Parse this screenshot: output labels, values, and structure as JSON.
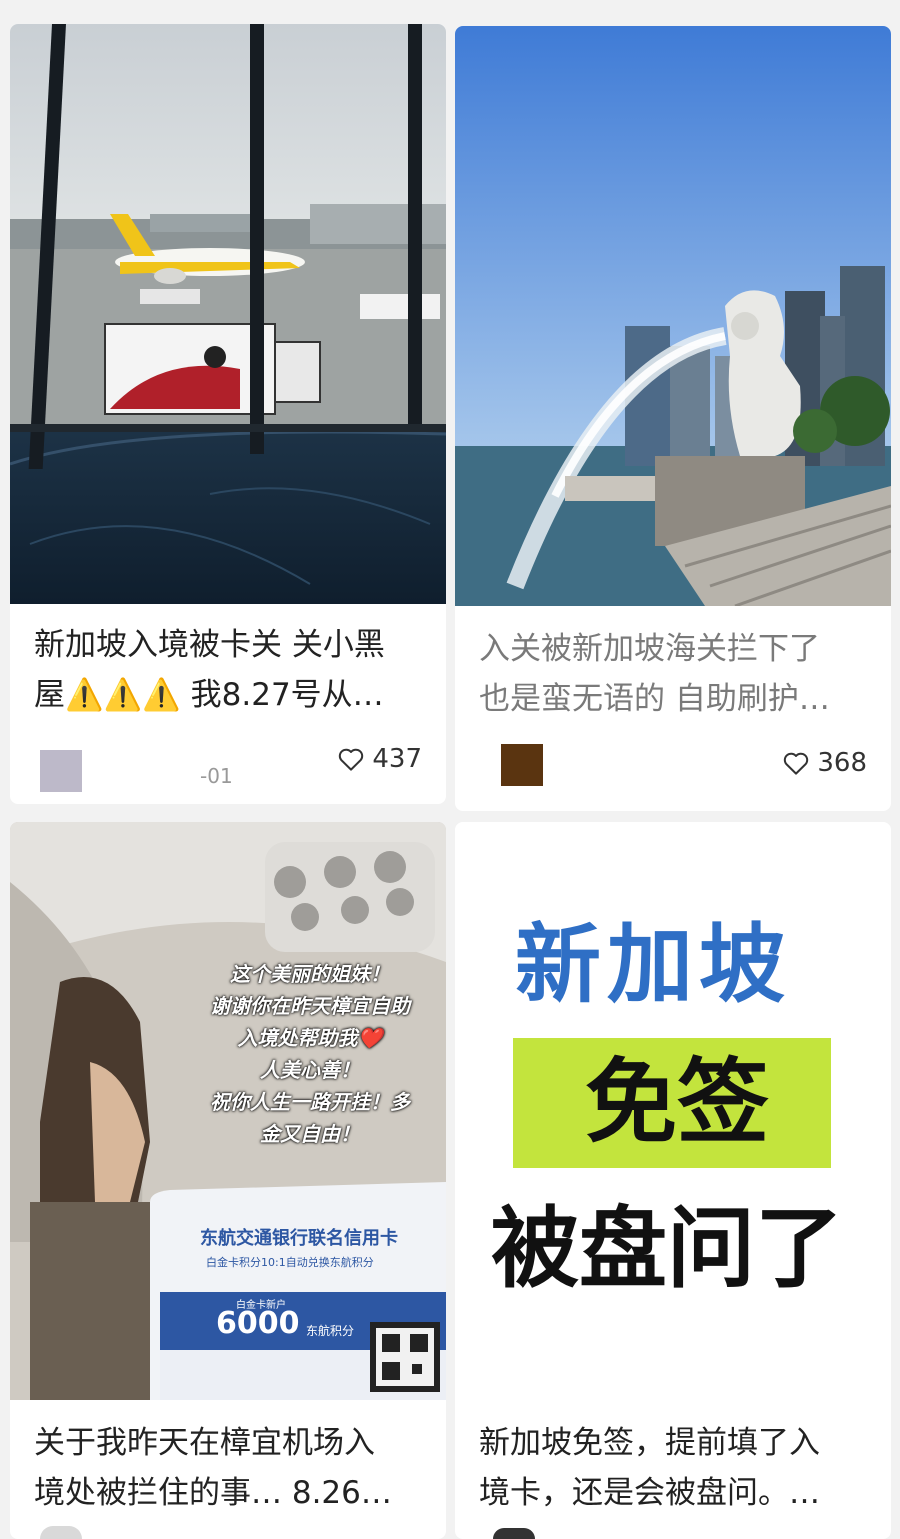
{
  "feed": {
    "cards": [
      {
        "caption_line1": "新加坡入境被卡关 关小黑",
        "caption_line2": "屋⚠️⚠️⚠️ 我8.27号从…",
        "meta_text": "-01",
        "likes": "437",
        "image_icon": "airport-window-image"
      },
      {
        "caption_line1": "入关被新加坡海关拦下了",
        "caption_line2": "也是蛮无语的 自助刷护…",
        "likes": "368",
        "image_icon": "merlion-image"
      },
      {
        "caption_line1": "关于我昨天在樟宜机场入",
        "caption_line2": "境处被拦住的事… 8.26…",
        "image_icon": "airplane-cabin-image",
        "overlay_lines": [
          "这个美丽的姐妹！",
          "谢谢你在昨天樟宜自助",
          "入境处帮助我❤️",
          "人美心善！",
          "祝你人生一路开挂！多",
          "金又自由！"
        ],
        "seatback_title": "东航交通银行联名信用卡",
        "seatback_sub": "白金卡积分10:1自动兑换东航积分",
        "seatback_badge_small": "白金卡新户",
        "seatback_number": "6000",
        "seatback_unit": "东航积分"
      },
      {
        "caption_line1": "新加坡免签，提前填了入",
        "caption_line2": "境卡，还是会被盘问。…",
        "image_icon": "text-graphic-image",
        "graphic_line1": "新加坡",
        "graphic_line2": "免签",
        "graphic_line3": "被盘问了"
      }
    ]
  },
  "colors": {
    "background": "#f2f2f2",
    "card": "#ffffff",
    "sky_blue": "#4a86d6",
    "graphic_blue": "#2f6fc5",
    "graphic_green": "#c3e43d"
  }
}
